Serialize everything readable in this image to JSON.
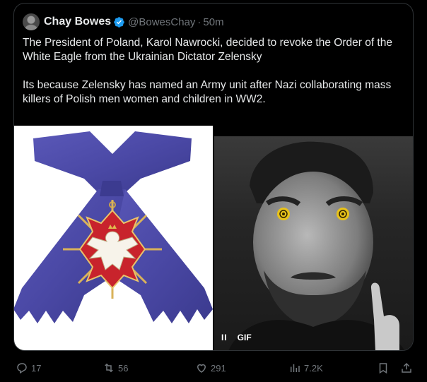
{
  "post": {
    "author_name": "Chay Bowes",
    "author_handle": "@BowesChay",
    "separator": "·",
    "time": "50m",
    "paragraphs": [
      "The President of Poland, Karol Nawrocki, decided to revoke the Order of the White Eagle from the Ukrainian Dictator Zelensky",
      "Its because Zelensky has named an Army unit after Nazi collaborating mass killers of Polish men women and children in WW2."
    ],
    "media": {
      "gif_label": "GIF",
      "pause_glyph": "II"
    },
    "actions": {
      "replies": "17",
      "reposts": "56",
      "likes": "291",
      "views": "7.2K"
    }
  },
  "colors": {
    "background": "#000000",
    "text": "#e7e9ea",
    "muted": "#71767b",
    "verified": "#1d9bf0",
    "border": "#2f3336"
  },
  "icons": [
    "verified-badge-icon",
    "pause-icon",
    "reply-icon",
    "repost-icon",
    "like-icon",
    "views-icon",
    "bookmark-icon",
    "share-icon"
  ]
}
